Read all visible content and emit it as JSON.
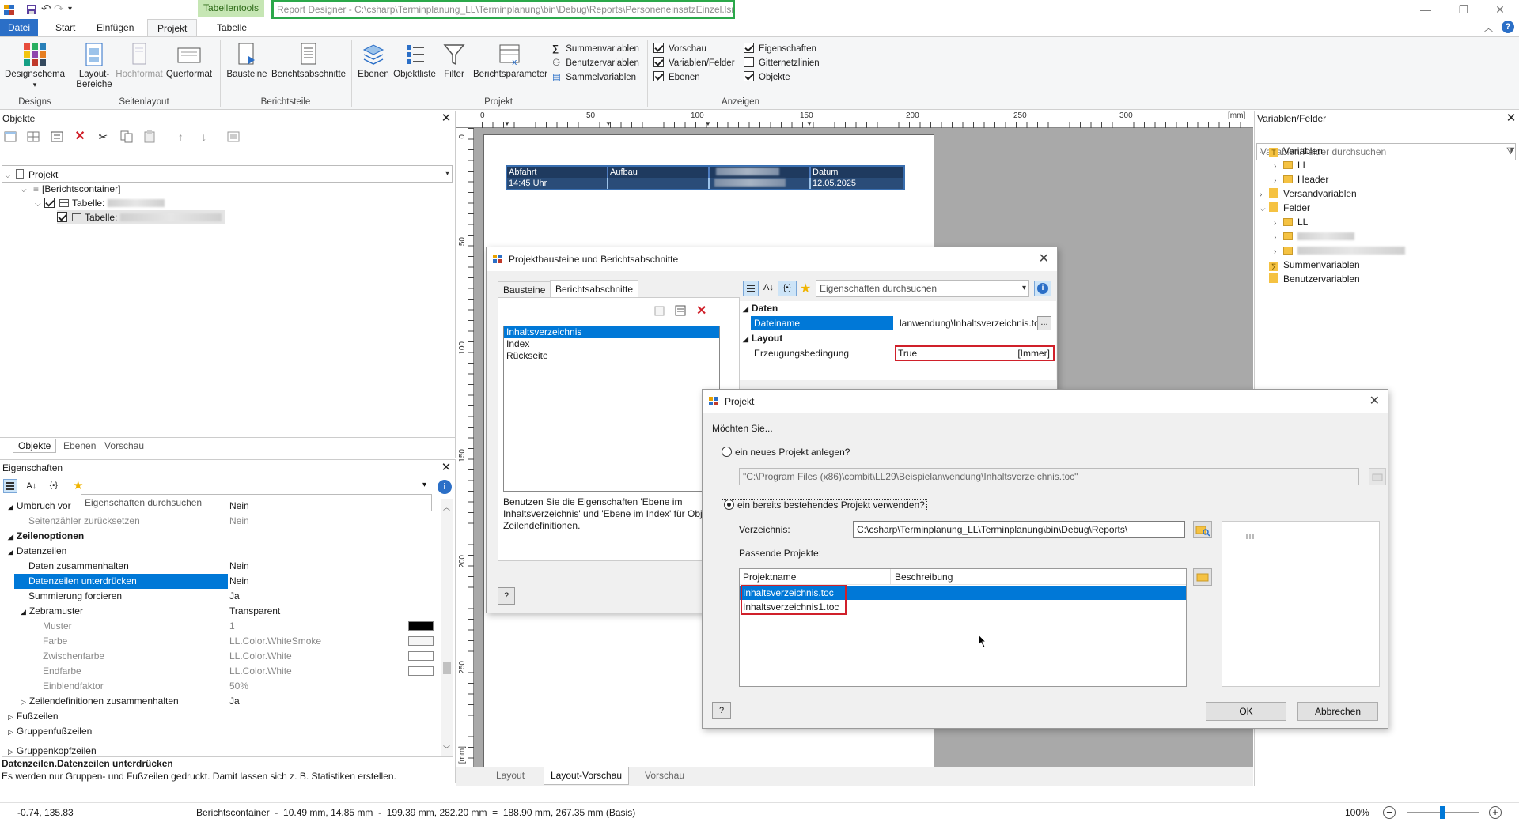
{
  "window": {
    "title": "Report Designer - C:\\csharp\\Terminplanung_LL\\Terminplanung\\bin\\Debug\\Reports\\PersoneneinsatzEinzel.lsr",
    "context_tab": "Tabellentools",
    "controls": [
      "—",
      "❐",
      "✕"
    ]
  },
  "ribbon_tabs": [
    "Datei",
    "Start",
    "Einfügen",
    "Projekt",
    "Tabelle"
  ],
  "ribbon": {
    "groups": {
      "designs": "Designs",
      "seitenlayout": "Seitenlayout",
      "berichtsteile": "Berichtsteile",
      "projekt": "Projekt",
      "anzeigen": "Anzeigen"
    },
    "buttons": {
      "designschema": "Designschema",
      "layout_bereiche": "Layout-\nBereiche",
      "hochformat": "Hochformat",
      "querformat": "Querformat",
      "bausteine": "Bausteine",
      "berichtsabschnitte": "Berichtsabschnitte",
      "ebenen": "Ebenen",
      "objektliste": "Objektliste",
      "filter": "Filter",
      "berichtsparameter": "Berichtsparameter"
    },
    "small_buttons": [
      "Summenvariablen",
      "Benutzervariablen",
      "Sammelvariablen"
    ],
    "checks_col1": [
      {
        "label": "Vorschau",
        "checked": true
      },
      {
        "label": "Variablen/Felder",
        "checked": true
      },
      {
        "label": "Ebenen",
        "checked": true
      }
    ],
    "checks_col2": [
      {
        "label": "Eigenschaften",
        "checked": true
      },
      {
        "label": "Gitternetzlinien",
        "checked": false
      },
      {
        "label": "Objekte",
        "checked": true
      }
    ]
  },
  "objects_panel": {
    "title": "Objekte",
    "tree": [
      "Projekt",
      "[Berichtscontainer]",
      "Tabelle:",
      "Tabelle:"
    ],
    "tabs": [
      "Objekte",
      "Ebenen",
      "Vorschau"
    ]
  },
  "properties_panel": {
    "title": "Eigenschaften",
    "search_placeholder": "Eigenschaften durchsuchen",
    "rows": [
      {
        "key": "Umbruch vor",
        "value": "Nein"
      },
      {
        "key": "Seitenzähler zurücksetzen",
        "value": "Nein"
      },
      {
        "key": "Zeilenoptionen",
        "value": ""
      },
      {
        "key": "Datenzeilen",
        "value": ""
      },
      {
        "key": "Daten zusammenhalten",
        "value": "Nein"
      },
      {
        "key": "Datenzeilen unterdrücken",
        "value": "Nein"
      },
      {
        "key": "Summierung forcieren",
        "value": "Ja"
      },
      {
        "key": "Zebramuster",
        "value": "Transparent"
      },
      {
        "key": "Muster",
        "value": "1"
      },
      {
        "key": "Farbe",
        "value": "LL.Color.WhiteSmoke"
      },
      {
        "key": "Zwischenfarbe",
        "value": "LL.Color.White"
      },
      {
        "key": "Endfarbe",
        "value": "LL.Color.White"
      },
      {
        "key": "Einblendfaktor",
        "value": "50%"
      },
      {
        "key": "Zeilendefinitionen zusammenhalten",
        "value": "Ja"
      },
      {
        "key": "Fußzeilen",
        "value": ""
      },
      {
        "key": "Gruppenfußzeilen",
        "value": ""
      },
      {
        "key": "Gruppenkopfzeilen",
        "value": ""
      }
    ],
    "desc_title": "Datenzeilen.Datenzeilen unterdrücken",
    "desc_text": "Es werden nur Gruppen- und Fußzeilen gedruckt. Damit lassen sich z. B. Statistiken erstellen."
  },
  "ruler": {
    "unit": "[mm]",
    "h_ticks": [
      "0",
      "50",
      "100",
      "150",
      "200",
      "250",
      "300"
    ],
    "v_ticks": [
      "0",
      "50",
      "100",
      "150",
      "200",
      "250"
    ],
    "v_unit": "[mm]"
  },
  "report_table": {
    "headers": [
      "Abfahrt",
      "Aufbau",
      "",
      "Datum"
    ],
    "row": [
      "14:45 Uhr",
      "",
      "",
      "12.05.2025"
    ]
  },
  "workspace_tabs": [
    "Layout",
    "Layout-Vorschau",
    "Vorschau"
  ],
  "variables_panel": {
    "title": "Variablen/Felder",
    "search_placeholder": "Variablen/Felder durchsuchen",
    "tree": [
      "Variablen",
      "LL",
      "Header",
      "Versandvariablen",
      "Felder",
      "LL",
      "",
      "",
      "Summenvariablen",
      "Benutzervariablen"
    ]
  },
  "dialog_bausteine": {
    "title": "Projektbausteine und Berichtsabschnitte",
    "tabs": [
      "Bausteine",
      "Berichtsabschnitte"
    ],
    "list": [
      "Inhaltsverzeichnis",
      "Index",
      "Rückseite"
    ],
    "info": "Benutzen Sie die Eigenschaften 'Ebene im Inhaltsverzeichnis' und 'Ebene im Index' für Obj und Zeilendefinitionen.",
    "search_placeholder": "Eigenschaften durchsuchen",
    "props": {
      "section_data": "Daten",
      "dateiname_key": "Dateiname",
      "dateiname_value": "lanwendung\\Inhaltsverzeichnis.tc",
      "section_layout": "Layout",
      "bedingung_key": "Erzeugungsbedingung",
      "bedingung_value": "True",
      "bedingung_tag": "[Immer]",
      "ellipsis": "..."
    }
  },
  "dialog_projekt": {
    "title": "Projekt",
    "question": "Möchten Sie...",
    "option_new": "ein neues Projekt anlegen?",
    "new_path": "\"C:\\Program Files (x86)\\combit\\LL29\\Beispielanwendung\\Inhaltsverzeichnis.toc\"",
    "option_existing": "ein bereits bestehendes Projekt verwenden?",
    "dir_label": "Verzeichnis:",
    "dir_value": "C:\\csharp\\Terminplanung_LL\\Terminplanung\\bin\\Debug\\Reports\\",
    "matching_label": "Passende Projekte:",
    "col_name": "Projektname",
    "col_desc": "Beschreibung",
    "projects": [
      "Inhaltsverzeichnis.toc",
      "Inhaltsverzeichnis1.toc"
    ],
    "ok": "OK",
    "cancel": "Abbrechen"
  },
  "status": {
    "coords": "-0.74, 135.83",
    "info": "Berichtscontainer  -  10.49 mm, 14.85 mm  -  199.39 mm, 282.20 mm  =  188.90 mm, 267.35 mm (Basis)",
    "zoom": "100%"
  },
  "colors": {
    "accent": "#0078d7",
    "file_tab": "#2b6fc7",
    "highlight_green": "#2ba84a",
    "highlight_red": "#d0202a",
    "context_tab": "#c6e6b4",
    "table_header": "#1f3a5f"
  }
}
